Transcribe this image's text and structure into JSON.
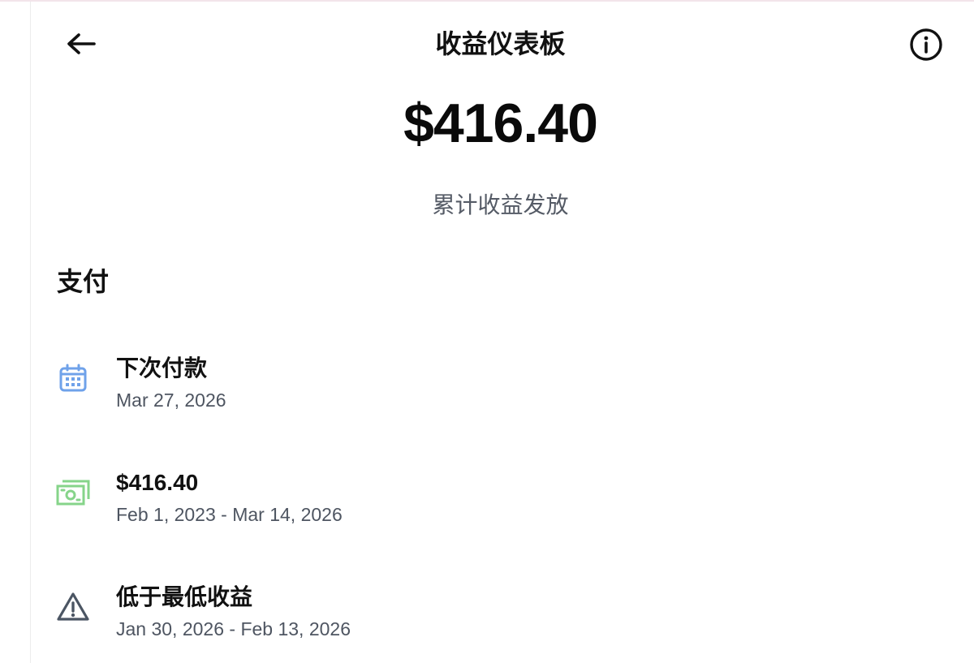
{
  "header": {
    "title": "收益仪表板",
    "back_icon": "arrow-left-icon",
    "info_icon": "info-circle-icon"
  },
  "summary": {
    "total_amount": "$416.40",
    "caption": "累计收益发放"
  },
  "payments": {
    "heading": "支付",
    "items": [
      {
        "icon": "calendar-icon",
        "icon_color": "#6fa2ea",
        "title": "下次付款",
        "subtitle": "Mar 27, 2026"
      },
      {
        "icon": "cash-icon",
        "icon_color": "#86d48a",
        "title": "$416.40",
        "subtitle": "Feb 1, 2023 - Mar 14, 2026"
      },
      {
        "icon": "warning-triangle-icon",
        "icon_color": "#4b5563",
        "title": "低于最低收益",
        "subtitle": "Jan 30, 2026 - Feb 13, 2026"
      }
    ]
  }
}
